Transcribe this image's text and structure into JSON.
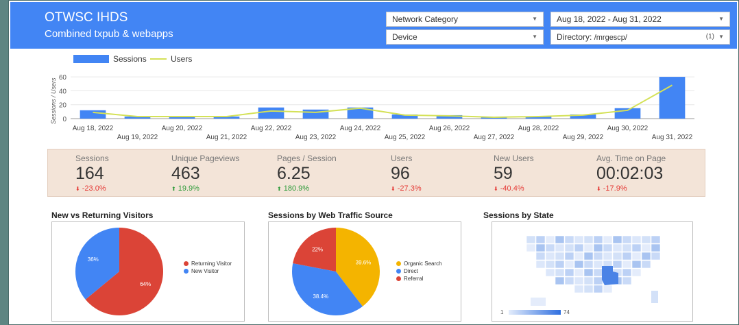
{
  "header": {
    "title": "OTWSC IHDS",
    "subtitle": "Combined txpub & webapps",
    "filters": {
      "network_category": "Network Category",
      "device": "Device",
      "date_range": "Aug 18, 2022 - Aug 31, 2022",
      "directory_label": "Directory:",
      "directory_value": "/mrgescp/",
      "directory_count": "(1)"
    }
  },
  "chart_data": {
    "type": "bar",
    "legend": [
      "Sessions",
      "Users"
    ],
    "ylabel": "Sessions / Users",
    "ylim": [
      0,
      65
    ],
    "yticks": [
      "60",
      "40",
      "20",
      "0"
    ],
    "categories": [
      "Aug 18, 2022",
      "Aug 19, 2022",
      "Aug 20, 2022",
      "Aug 21, 2022",
      "Aug 22, 2022",
      "Aug 23, 2022",
      "Aug 24, 2022",
      "Aug 25, 2022",
      "Aug 26, 2022",
      "Aug 27, 2022",
      "Aug 28, 2022",
      "Aug 29, 2022",
      "Aug 30, 2022",
      "Aug 31, 2022"
    ],
    "series": [
      {
        "name": "Sessions",
        "type": "bar",
        "color": "#4285f4",
        "values": [
          12,
          3,
          3,
          3,
          16,
          13,
          16,
          6,
          5,
          2,
          3,
          6,
          15,
          60
        ]
      },
      {
        "name": "Users",
        "type": "line",
        "color": "#d4e157",
        "values": [
          9,
          3,
          3,
          3,
          11,
          9,
          15,
          5,
          4,
          2,
          3,
          5,
          12,
          48
        ]
      }
    ]
  },
  "scorecards": [
    {
      "label": "Sessions",
      "value": "164",
      "delta": "-23.0%",
      "dir": "down"
    },
    {
      "label": "Unique Pageviews",
      "value": "463",
      "delta": "19.9%",
      "dir": "up"
    },
    {
      "label": "Pages / Session",
      "value": "6.25",
      "delta": "180.9%",
      "dir": "up"
    },
    {
      "label": "Users",
      "value": "96",
      "delta": "-27.3%",
      "dir": "down"
    },
    {
      "label": "New Users",
      "value": "59",
      "delta": "-40.4%",
      "dir": "down"
    },
    {
      "label": "Avg. Time on Page",
      "value": "00:02:03",
      "delta": "-17.9%",
      "dir": "down"
    }
  ],
  "panels": {
    "visitors": {
      "title": "New vs Returning Visitors",
      "slices": [
        {
          "label": "Returning Visitor",
          "pct": "64%",
          "value": 64,
          "color": "#db4437"
        },
        {
          "label": "New Visitor",
          "pct": "36%",
          "value": 36,
          "color": "#4285f4"
        }
      ]
    },
    "traffic": {
      "title": "Sessions by Web Traffic Source",
      "slices": [
        {
          "label": "Organic Search",
          "pct": "39.6%",
          "value": 39.6,
          "color": "#f4b400"
        },
        {
          "label": "Direct",
          "pct": "38.4%",
          "value": 38.4,
          "color": "#4285f4"
        },
        {
          "label": "Referral",
          "pct": "22%",
          "value": 22,
          "color": "#db4437"
        }
      ]
    },
    "state": {
      "title": "Sessions by State",
      "scale_min": "1",
      "scale_max": "74"
    }
  }
}
